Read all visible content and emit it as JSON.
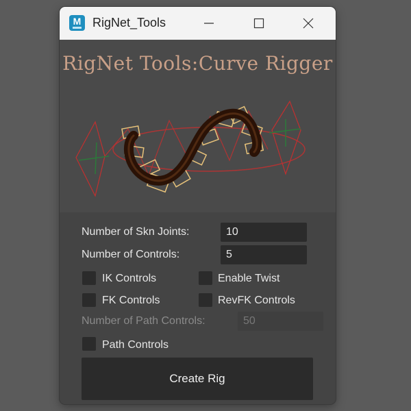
{
  "window": {
    "title": "RigNet_Tools",
    "app_icon_letter": "M"
  },
  "banner": {
    "title": "RigNet Tools:Curve Rigger",
    "image": "curve-rig-illustration"
  },
  "form": {
    "skn_joints_label": "Number of Skn Joints:",
    "skn_joints_value": "10",
    "controls_label": "Number of Controls:",
    "controls_value": "5",
    "ik_label": "IK Controls",
    "twist_label": "Enable Twist",
    "fk_label": "FK Controls",
    "revfk_label": "RevFK Controls",
    "path_controls_count_label": "Number of Path Controls:",
    "path_controls_count_value": "50",
    "path_label": "Path Controls",
    "create_label": "Create Rig"
  },
  "icons": {
    "minimize": "minimize-icon",
    "maximize": "maximize-icon",
    "close": "close-icon"
  },
  "colors": {
    "desktop": "#5b5b5b",
    "window_bg": "#444444",
    "titlebar_bg": "#f3f3f3",
    "field_bg": "#2b2b2b",
    "banner_text": "#c9a088",
    "app_icon": "#1f8fbf"
  }
}
